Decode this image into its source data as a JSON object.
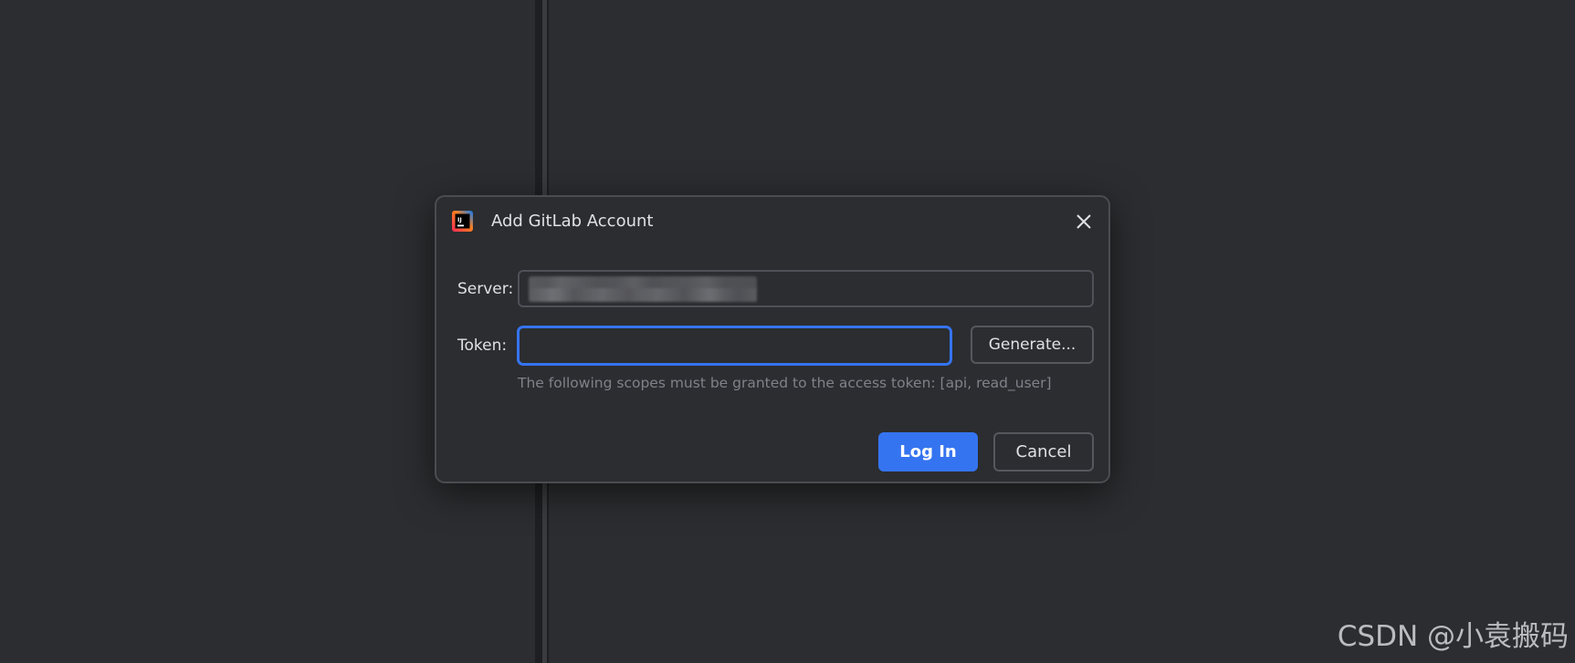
{
  "dialog": {
    "title": "Add GitLab Account",
    "app_icon": "intellij-idea-icon",
    "close_icon": "close-icon"
  },
  "form": {
    "server_label": "Server:",
    "server_value": "",
    "token_label": "Token:",
    "token_value": "",
    "generate_label": "Generate...",
    "hint": "The following scopes must be granted to the access token: [api, read_user]"
  },
  "buttons": {
    "login_label": "Log In",
    "cancel_label": "Cancel"
  },
  "watermark": "CSDN @小袁搬码",
  "colors": {
    "background": "#2b2d30",
    "accent": "#3574f0",
    "text": "#dfe1e5",
    "hint_text": "#80828a",
    "border": "#4e5157"
  }
}
